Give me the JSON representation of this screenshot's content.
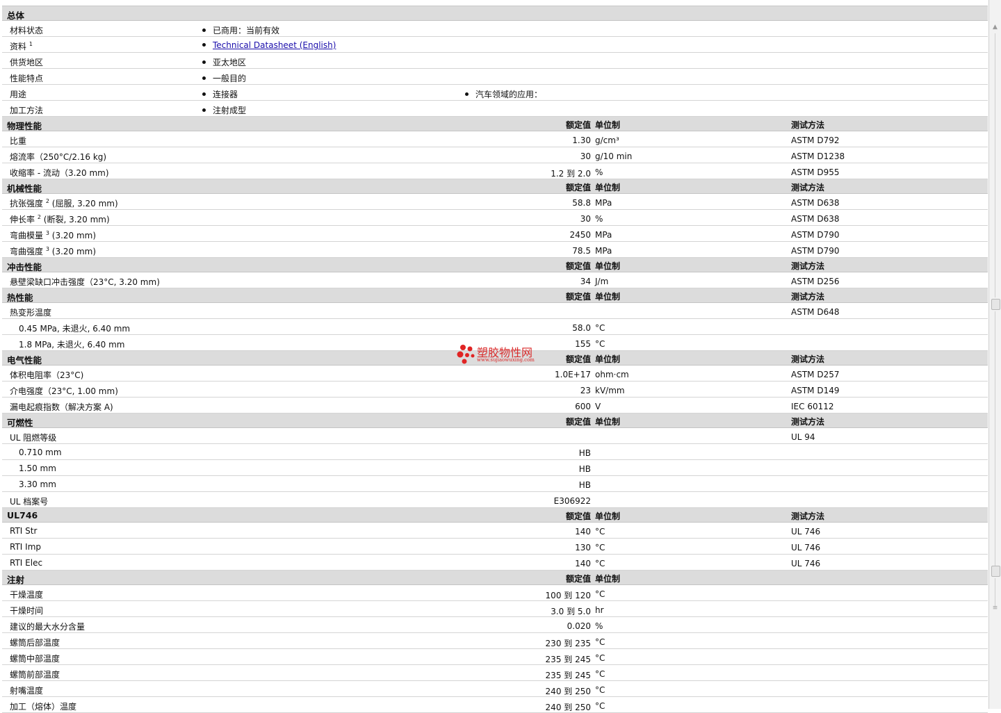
{
  "sections": {
    "general": {
      "title": "总体",
      "rows": [
        {
          "label": "材料状态",
          "items": [
            "已商用：当前有效"
          ]
        },
        {
          "label": "资料",
          "sup": "1",
          "link": "Technical Datasheet (English)"
        },
        {
          "label": "供货地区",
          "items": [
            "亚太地区"
          ]
        },
        {
          "label": "性能特点",
          "items": [
            "一般目的"
          ]
        },
        {
          "label": "用途",
          "items": [
            "连接器",
            "汽车领域的应用："
          ]
        },
        {
          "label": "加工方法",
          "items": [
            "注射成型"
          ]
        }
      ]
    },
    "headers": {
      "value": "额定值",
      "unit": "单位制",
      "test": "测试方法"
    },
    "physical": {
      "title": "物理性能",
      "rows": [
        {
          "label": "比重",
          "value": "1.30",
          "unit": "g/cm³",
          "test": "ASTM D792"
        },
        {
          "label": "熔流率（250°C/2.16 kg)",
          "value": "30",
          "unit": "g/10 min",
          "test": "ASTM D1238"
        },
        {
          "label": "收缩率 - 流动（3.20 mm)",
          "value": "1.2 到  2.0",
          "unit": "%",
          "test": "ASTM D955"
        }
      ]
    },
    "mechanical": {
      "title": "机械性能",
      "rows": [
        {
          "label": "抗张强度",
          "sup": "2",
          "label2": "(屈服, 3.20 mm)",
          "value": "58.8",
          "unit": "MPa",
          "test": "ASTM D638"
        },
        {
          "label": "伸长率",
          "sup": "2",
          "label2": "(断裂, 3.20 mm)",
          "value": "30",
          "unit": "%",
          "test": "ASTM D638"
        },
        {
          "label": "弯曲模量",
          "sup": "3",
          "label2": "(3.20 mm)",
          "value": "2450",
          "unit": "MPa",
          "test": "ASTM D790"
        },
        {
          "label": "弯曲强度",
          "sup": "3",
          "label2": "(3.20 mm)",
          "value": "78.5",
          "unit": "MPa",
          "test": "ASTM D790"
        }
      ]
    },
    "impact": {
      "title": "冲击性能",
      "rows": [
        {
          "label": "悬壁梁缺口冲击强度（23°C, 3.20 mm)",
          "value": "34",
          "unit": "J/m",
          "test": "ASTM D256"
        }
      ]
    },
    "thermal": {
      "title": "热性能",
      "rows": [
        {
          "label": "热变形温度",
          "test": "ASTM D648"
        },
        {
          "label": "0.45 MPa, 未退火, 6.40 mm",
          "value": "58.0",
          "unit": "°C"
        },
        {
          "label": "1.8 MPa, 未退火, 6.40 mm",
          "value": "155",
          "unit": "°C"
        }
      ]
    },
    "electrical": {
      "title": "电气性能",
      "rows": [
        {
          "label": "体积电阻率（23°C)",
          "value": "1.0E+17",
          "unit": "ohm·cm",
          "test": "ASTM D257"
        },
        {
          "label": "介电强度（23°C, 1.00 mm)",
          "value": "23",
          "unit": "kV/mm",
          "test": "ASTM D149"
        },
        {
          "label": "漏电起痕指数（解决方案 A)",
          "value": "600",
          "unit": "V",
          "test": "IEC 60112"
        }
      ]
    },
    "flammability": {
      "title": "可燃性",
      "rows": [
        {
          "label": "UL 阻燃等级",
          "test": "UL 94"
        },
        {
          "label": "0.710 mm",
          "value": "HB"
        },
        {
          "label": "1.50 mm",
          "value": "HB"
        },
        {
          "label": "3.30 mm",
          "value": "HB"
        },
        {
          "label": "UL 档案号",
          "value": "E306922"
        }
      ]
    },
    "ul746": {
      "title": "UL746",
      "rows": [
        {
          "label": "RTI Str",
          "value": "140",
          "unit": "°C",
          "test": "UL 746"
        },
        {
          "label": "RTI Imp",
          "value": "130",
          "unit": "°C",
          "test": "UL 746"
        },
        {
          "label": "RTI Elec",
          "value": "140",
          "unit": "°C",
          "test": "UL 746"
        }
      ]
    },
    "injection": {
      "title": "注射",
      "rows": [
        {
          "label": "干燥温度",
          "value": "100 到  120",
          "unit": "°C"
        },
        {
          "label": "干燥时间",
          "value": "3.0 到  5.0",
          "unit": "hr"
        },
        {
          "label": "建议的最大水分含量",
          "value": "0.020",
          "unit": "%"
        },
        {
          "label": "螺筒后部温度",
          "value": "230 到  235",
          "unit": "°C"
        },
        {
          "label": "螺筒中部温度",
          "value": "235 到  245",
          "unit": "°C"
        },
        {
          "label": "螺筒前部温度",
          "value": "235 到  245",
          "unit": "°C"
        },
        {
          "label": "射嘴温度",
          "value": "240 到  250",
          "unit": "°C"
        },
        {
          "label": "加工（熔体）温度",
          "value": "240 到  250",
          "unit": "°C"
        }
      ]
    }
  },
  "watermark": {
    "name": "塑胶物性网",
    "url": "www.sujiaowuxing.com"
  },
  "colors": {
    "header_bg": "#dcdcdc",
    "row_border": "#d4d4d4",
    "link": "#1a0dab",
    "watermark": "#d92a2a"
  },
  "icons": {
    "scroll_up": "scroll-up-arrow-icon",
    "scroll_grip": "scroll-grip-icon"
  }
}
